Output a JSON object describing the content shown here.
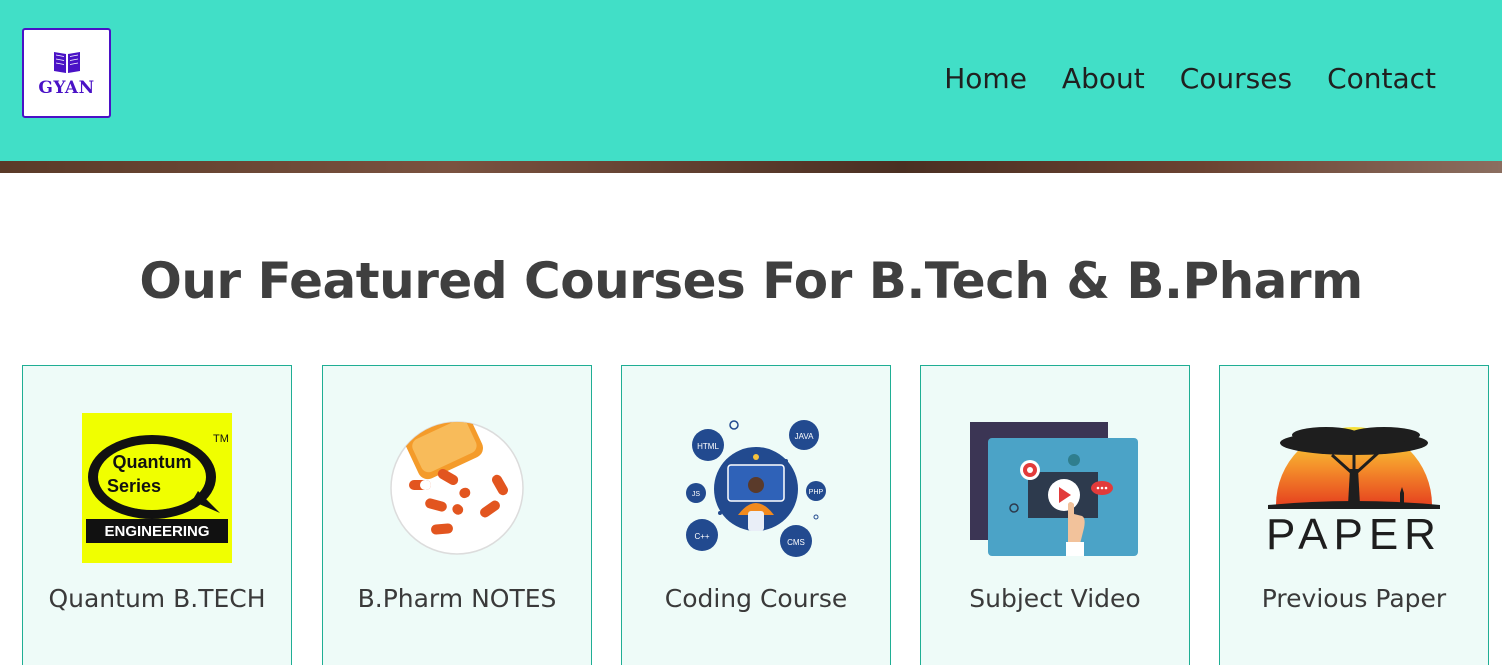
{
  "header": {
    "logo_text": "GYAN",
    "nav": [
      {
        "label": "Home"
      },
      {
        "label": "About"
      },
      {
        "label": "Courses"
      },
      {
        "label": "Contact"
      }
    ]
  },
  "section": {
    "title": "Our Featured Courses For B.Tech & B.Pharm"
  },
  "cards": [
    {
      "label": "Quantum B.TECH",
      "image": "quantum-series-logo"
    },
    {
      "label": "B.Pharm NOTES",
      "image": "pills-image"
    },
    {
      "label": "Coding Course",
      "image": "coding-illustration"
    },
    {
      "label": "Subject Video",
      "image": "video-illustration"
    },
    {
      "label": "Previous Paper",
      "image": "paper-logo"
    }
  ],
  "quantum_logo": {
    "line1": "Quantum",
    "line2": "Series",
    "tm": "TM",
    "banner": "ENGINEERING"
  },
  "coding_badges": [
    "HTML",
    "JAVA",
    "JS",
    "PHP",
    "C++",
    "CMS"
  ],
  "paper_logo": {
    "word": "PAPER"
  },
  "colors": {
    "header_bg": "#41dfc7",
    "logo_accent": "#4a12c6",
    "card_bg": "#eefbf8",
    "card_border": "#1fae94"
  }
}
